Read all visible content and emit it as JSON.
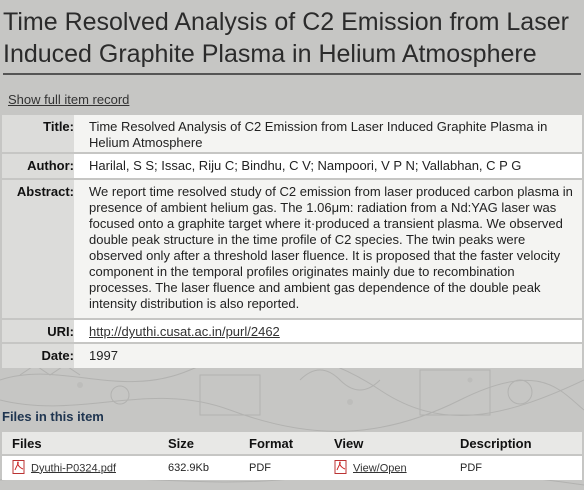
{
  "page": {
    "title": "Time Resolved Analysis of C2 Emission from Laser Induced Graphite Plasma in Helium Atmosphere",
    "show_full_record": "Show full item record"
  },
  "metadata": [
    {
      "label": "Title:",
      "value": "Time Resolved Analysis of C2 Emission from Laser Induced Graphite Plasma in Helium Atmosphere"
    },
    {
      "label": "Author:",
      "value": "Harilal, S S; Issac, Riju C; Bindhu, C V; Nampoori, V P N; Vallabhan, C P G"
    },
    {
      "label": "Abstract:",
      "value": "We report time resolved study of C2 emission from laser produced carbon plasma in presence of ambient helium gas. The 1.06μm: radiation from a Nd:YAG laser was focused onto a graphite target where it·produced a transient plasma. We observed double peak structure in the time profile of C2 species. The twin peaks were observed only after a threshold laser fluence. It is proposed that the faster velocity component in the temporal profiles originates mainly due to recombination processes. The laser fluence and ambient gas dependence of the double peak intensity distribution is also reported."
    },
    {
      "label": "URI:",
      "value": "http://dyuthi.cusat.ac.in/purl/2462"
    },
    {
      "label": "Date:",
      "value": "1997"
    }
  ],
  "files": {
    "heading": "Files in this item",
    "columns": [
      "Files",
      "Size",
      "Format",
      "View",
      "Description"
    ],
    "rows": [
      {
        "file": "Dyuthi-P0324.pdf",
        "size": "632.9Kb",
        "format": "PDF",
        "view": "View/Open",
        "description": "PDF"
      }
    ]
  },
  "icons": {
    "file_icon": "pdf-icon",
    "view_icon": "pdf-icon"
  },
  "colors": {
    "files_heading": "#1f3550",
    "label_bg": "#dcdcda",
    "background": "#c8c8c6"
  }
}
